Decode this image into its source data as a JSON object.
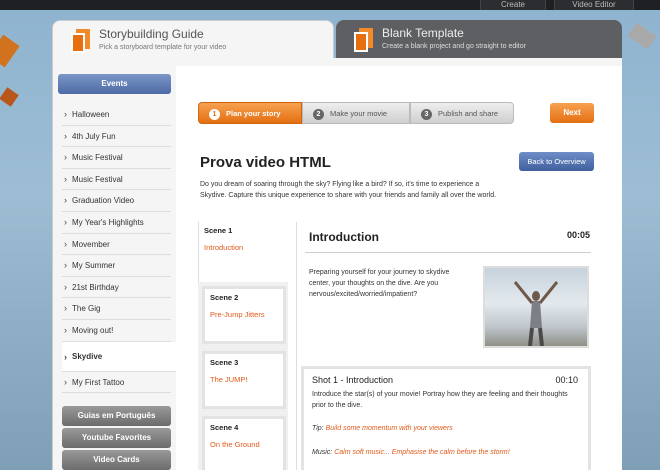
{
  "topnav": {
    "create": "Create",
    "video_editor": "Video Editor"
  },
  "tabs": {
    "guide": {
      "title": "Storybuilding Guide",
      "subtitle": "Pick a storyboard template for your video"
    },
    "blank": {
      "title": "Blank Template",
      "subtitle": "Create a blank project and go straight to editor"
    }
  },
  "sidebar": {
    "category_events": "Events",
    "items": [
      {
        "label": "Halloween"
      },
      {
        "label": "4th July Fun"
      },
      {
        "label": "Music Festival"
      },
      {
        "label": "Music Festival"
      },
      {
        "label": "Graduation Video"
      },
      {
        "label": "My Year's Highlights"
      },
      {
        "label": "Movember"
      },
      {
        "label": "My Summer"
      },
      {
        "label": "21st Birthday"
      },
      {
        "label": "The Gig"
      },
      {
        "label": "Moving out!"
      },
      {
        "label": "Skydive"
      },
      {
        "label": "My First Tattoo"
      }
    ],
    "categories": [
      {
        "label": "Guias em Português"
      },
      {
        "label": "Youtube Favorites"
      },
      {
        "label": "Video Cards"
      }
    ]
  },
  "steps": [
    {
      "num": "1",
      "label": "Plan your story"
    },
    {
      "num": "2",
      "label": "Make your movie"
    },
    {
      "num": "3",
      "label": "Publish and share"
    }
  ],
  "next_label": "Next",
  "page_title": "Prova video HTML",
  "back_label": "Back to Overview",
  "intro_text": "Do you dream of soaring through the sky? Flying like a bird? If so, it's time to experience a Skydive. Capture this unique experience to share with your friends and family all over the world.",
  "scenes": [
    {
      "name": "Scene 1",
      "title": "Introduction"
    },
    {
      "name": "Scene 2",
      "title": "Pre-Jump Jitters"
    },
    {
      "name": "Scene 3",
      "title": "The JUMP!"
    },
    {
      "name": "Scene 4",
      "title": "On the Ground"
    }
  ],
  "section": {
    "title": "Introduction",
    "time": "00:05",
    "text": "Preparing yourself for your journey to skydive center, your thoughts on the dive. Are you nervous/excited/worried/impatient?"
  },
  "shot": {
    "title": "Shot 1 - Introduction",
    "time": "00:10",
    "desc": "Introduce the star(s) of your movie! Portray how they are feeling and their thoughts prior to the dive.",
    "tip_label": "Tip:",
    "tip_text": "Build some momentum with your viewers",
    "music_label": "Music:",
    "music_text": "Calm soft music... Emphasise the calm before the storm!"
  },
  "colors": {
    "accent": "#e46f12",
    "link": "#e05a1a",
    "primary_blue": "#4d6aa6"
  }
}
